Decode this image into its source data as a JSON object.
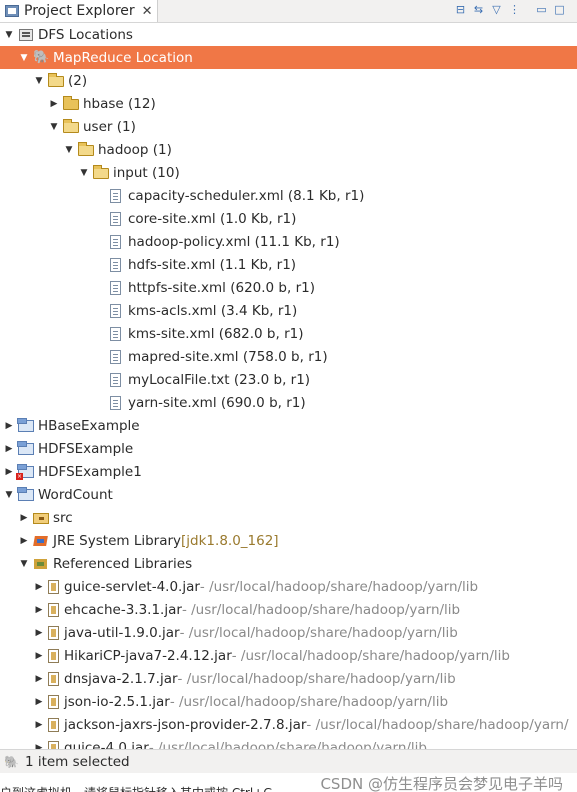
{
  "tab": {
    "title": "Project Explorer",
    "close": "✕"
  },
  "toolbar": {
    "collapse_icon": "⊟",
    "link_icon": "⇆",
    "filter_icon": "▽",
    "menu_icon": "⋮",
    "minimize_icon": "▭",
    "maximize_icon": "□"
  },
  "tree": [
    {
      "level": 0,
      "arrow": "down",
      "icon": "dfs",
      "label": "DFS Locations"
    },
    {
      "level": 1,
      "arrow": "down",
      "icon": "elephant",
      "label": "MapReduce Location",
      "selected": true
    },
    {
      "level": 2,
      "arrow": "down",
      "icon": "folder-open",
      "label": "(2)"
    },
    {
      "level": 3,
      "arrow": "right",
      "icon": "folder",
      "label": "hbase (12)"
    },
    {
      "level": 3,
      "arrow": "down",
      "icon": "folder-open",
      "label": "user (1)"
    },
    {
      "level": 4,
      "arrow": "down",
      "icon": "folder-open",
      "label": "hadoop (1)"
    },
    {
      "level": 5,
      "arrow": "down",
      "icon": "folder-open",
      "label": "input (10)"
    },
    {
      "level": 6,
      "arrow": "none",
      "icon": "file",
      "label": "capacity-scheduler.xml (8.1 Kb, r1)"
    },
    {
      "level": 6,
      "arrow": "none",
      "icon": "file",
      "label": "core-site.xml (1.0 Kb, r1)"
    },
    {
      "level": 6,
      "arrow": "none",
      "icon": "file",
      "label": "hadoop-policy.xml (11.1 Kb, r1)"
    },
    {
      "level": 6,
      "arrow": "none",
      "icon": "file",
      "label": "hdfs-site.xml (1.1 Kb, r1)"
    },
    {
      "level": 6,
      "arrow": "none",
      "icon": "file",
      "label": "httpfs-site.xml (620.0 b, r1)"
    },
    {
      "level": 6,
      "arrow": "none",
      "icon": "file",
      "label": "kms-acls.xml (3.4 Kb, r1)"
    },
    {
      "level": 6,
      "arrow": "none",
      "icon": "file",
      "label": "kms-site.xml (682.0 b, r1)"
    },
    {
      "level": 6,
      "arrow": "none",
      "icon": "file",
      "label": "mapred-site.xml (758.0 b, r1)"
    },
    {
      "level": 6,
      "arrow": "none",
      "icon": "file",
      "label": "myLocalFile.txt (23.0 b, r1)"
    },
    {
      "level": 6,
      "arrow": "none",
      "icon": "file",
      "label": "yarn-site.xml (690.0 b, r1)"
    },
    {
      "level": 0,
      "arrow": "right",
      "icon": "project",
      "label": "HBaseExample"
    },
    {
      "level": 0,
      "arrow": "right",
      "icon": "project",
      "label": "HDFSExample"
    },
    {
      "level": 0,
      "arrow": "right",
      "icon": "project-error",
      "label": "HDFSExample1"
    },
    {
      "level": 0,
      "arrow": "down",
      "icon": "project",
      "label": "WordCount"
    },
    {
      "level": 1,
      "arrow": "right",
      "icon": "src",
      "label": "src"
    },
    {
      "level": 1,
      "arrow": "right",
      "icon": "jre",
      "label": "JRE System Library ",
      "extra": "[jdk1.8.0_162]",
      "extra_class": "jdk"
    },
    {
      "level": 1,
      "arrow": "down",
      "icon": "libs",
      "label": "Referenced Libraries"
    },
    {
      "level": 2,
      "arrow": "right",
      "icon": "jar",
      "label": "guice-servlet-4.0.jar",
      "extra": " - /usr/local/hadoop/share/hadoop/yarn/lib",
      "extra_class": "path"
    },
    {
      "level": 2,
      "arrow": "right",
      "icon": "jar",
      "label": "ehcache-3.3.1.jar",
      "extra": " - /usr/local/hadoop/share/hadoop/yarn/lib",
      "extra_class": "path"
    },
    {
      "level": 2,
      "arrow": "right",
      "icon": "jar",
      "label": "java-util-1.9.0.jar",
      "extra": " - /usr/local/hadoop/share/hadoop/yarn/lib",
      "extra_class": "path"
    },
    {
      "level": 2,
      "arrow": "right",
      "icon": "jar",
      "label": "HikariCP-java7-2.4.12.jar",
      "extra": " - /usr/local/hadoop/share/hadoop/yarn/lib",
      "extra_class": "path"
    },
    {
      "level": 2,
      "arrow": "right",
      "icon": "jar",
      "label": "dnsjava-2.1.7.jar",
      "extra": " - /usr/local/hadoop/share/hadoop/yarn/lib",
      "extra_class": "path"
    },
    {
      "level": 2,
      "arrow": "right",
      "icon": "jar",
      "label": "json-io-2.5.1.jar",
      "extra": " - /usr/local/hadoop/share/hadoop/yarn/lib",
      "extra_class": "path"
    },
    {
      "level": 2,
      "arrow": "right",
      "icon": "jar",
      "label": "jackson-jaxrs-json-provider-2.7.8.jar",
      "extra": " - /usr/local/hadoop/share/hadoop/yarn/",
      "extra_class": "path"
    },
    {
      "level": 2,
      "arrow": "right",
      "icon": "jar",
      "label": "guice-4.0.jar",
      "extra": " - /usr/local/hadoop/share/hadoop/yarn/lib",
      "extra_class": "path"
    }
  ],
  "status": {
    "text": "1 item selected",
    "icon": "elephant-icon"
  },
  "bottom": {
    "text": "户到这虚拟机，请将鼠标指针移入其中或按 Ctrl+G",
    "watermark": "CSDN @仿生程序员会梦见电子羊吗"
  },
  "colors": {
    "selection": "#f07746",
    "path": "#8a8a8a",
    "jdk": "#9a7a2e"
  }
}
